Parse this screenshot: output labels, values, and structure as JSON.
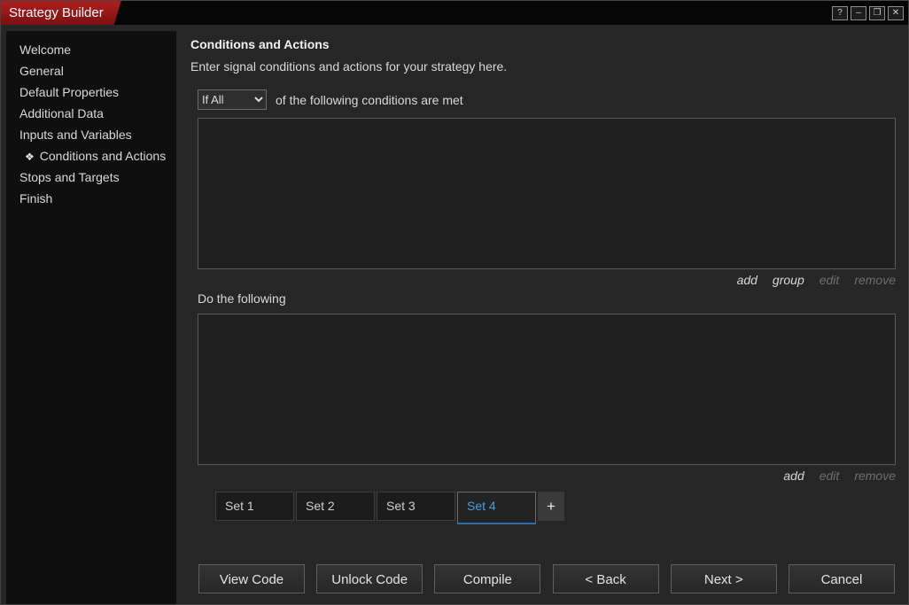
{
  "window": {
    "title": "Strategy Builder",
    "controls": [
      {
        "name": "help",
        "glyph": "?"
      },
      {
        "name": "minimize",
        "glyph": "–"
      },
      {
        "name": "maximize",
        "glyph": "❐"
      },
      {
        "name": "close",
        "glyph": "✕"
      }
    ]
  },
  "sidebar": {
    "items": [
      {
        "label": "Welcome"
      },
      {
        "label": "General"
      },
      {
        "label": "Default Properties"
      },
      {
        "label": "Additional Data"
      },
      {
        "label": "Inputs and Variables"
      },
      {
        "label": "Conditions and Actions",
        "icon": "❖",
        "active": true
      },
      {
        "label": "Stops and Targets"
      },
      {
        "label": "Finish"
      }
    ]
  },
  "main": {
    "heading": "Conditions and Actions",
    "subtitle": "Enter signal conditions and actions for your strategy here.",
    "conditions": {
      "operator_value": "If All",
      "caption": "of the following conditions are met",
      "links": {
        "add": "add",
        "group": "group",
        "edit": "edit",
        "remove": "remove"
      }
    },
    "actions": {
      "label": "Do the following",
      "links": {
        "add": "add",
        "edit": "edit",
        "remove": "remove"
      }
    },
    "tabs": {
      "set1": "Set 1",
      "set2": "Set 2",
      "set3": "Set 3",
      "set4": "Set 4",
      "add": "+"
    },
    "buttons": {
      "view_code": "View Code",
      "unlock_code": "Unlock Code",
      "compile": "Compile",
      "back": "< Back",
      "next": "Next >",
      "cancel": "Cancel"
    }
  },
  "colors": {
    "title_accent_red": "#9e1a1a",
    "active_tab_blue": "#41a0e8",
    "panel_border": "#585858",
    "sidebar_bg": "#0f0f0f",
    "main_bg": "#262626"
  }
}
